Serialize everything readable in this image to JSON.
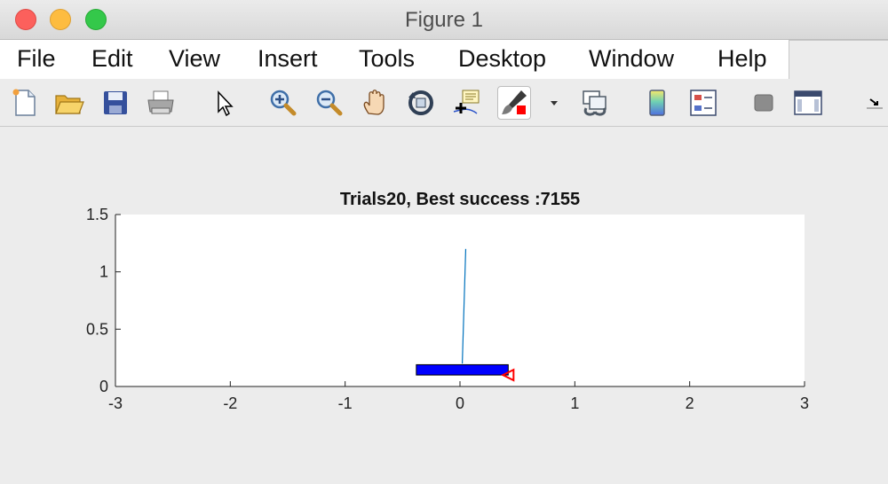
{
  "window": {
    "title": "Figure 1"
  },
  "menu": [
    {
      "label": "File"
    },
    {
      "label": "Edit"
    },
    {
      "label": "View"
    },
    {
      "label": "Insert"
    },
    {
      "label": "Tools"
    },
    {
      "label": "Desktop"
    },
    {
      "label": "Window"
    },
    {
      "label": "Help"
    }
  ],
  "toolbar": [
    {
      "icon": "new-figure-icon"
    },
    {
      "icon": "open-folder-icon"
    },
    {
      "icon": "save-icon"
    },
    {
      "icon": "print-icon"
    },
    {
      "icon": "arrow-pointer-icon"
    },
    {
      "icon": "zoom-in-icon"
    },
    {
      "icon": "zoom-out-icon"
    },
    {
      "icon": "pan-hand-icon"
    },
    {
      "icon": "rotate-3d-icon"
    },
    {
      "icon": "data-cursor-icon"
    },
    {
      "icon": "brush-icon"
    },
    {
      "icon": "link-plot-icon"
    },
    {
      "icon": "colorbar-icon"
    },
    {
      "icon": "legend-icon"
    },
    {
      "icon": "hide-plot-tools-icon"
    },
    {
      "icon": "show-plot-tools-icon"
    },
    {
      "icon": "dock-arrow-icon"
    }
  ],
  "chart_data": {
    "type": "line",
    "title": "Trials20, Best success :7155",
    "xlabel": "",
    "ylabel": "",
    "xlim": [
      -3,
      3
    ],
    "ylim": [
      0,
      1.5
    ],
    "xticks": [
      "-3",
      "-2",
      "-1",
      "0",
      "1",
      "2",
      "3"
    ],
    "yticks": [
      "0",
      "0.5",
      "1",
      "1.5"
    ],
    "grid": false,
    "colors": {
      "cart": "#0000ff",
      "pole": "#0072bd",
      "marker": "#ff0000",
      "axes_bg": "#ffffff"
    },
    "cart": {
      "x_min": -0.38,
      "x_max": 0.42,
      "y_min": 0.1,
      "y_max": 0.19
    },
    "pole": {
      "x": [
        0.02,
        0.05
      ],
      "y": [
        0.2,
        1.2
      ]
    },
    "marker": {
      "x": 0.42,
      "y": 0.1,
      "shape": "left-triangle"
    }
  }
}
